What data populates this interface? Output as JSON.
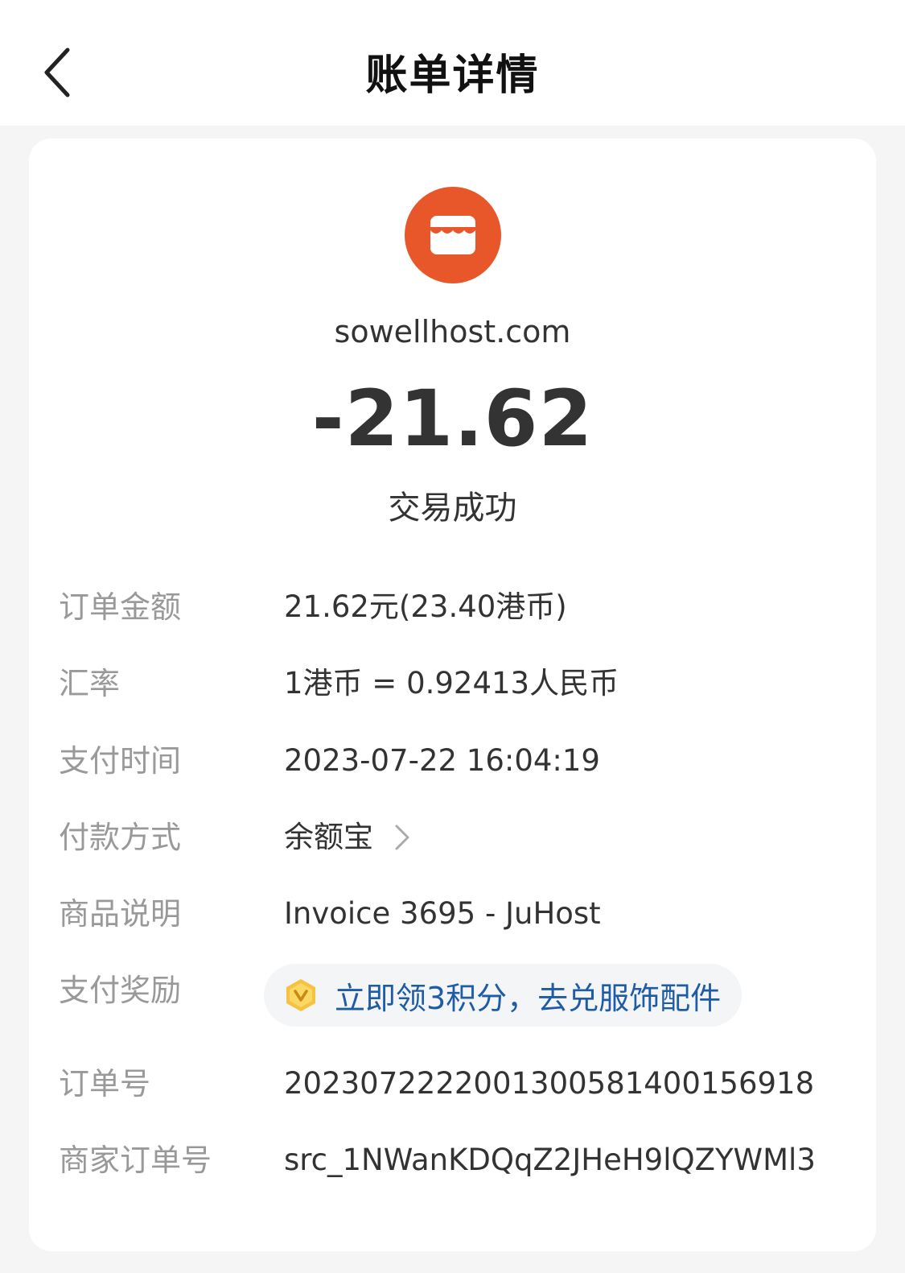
{
  "nav": {
    "title": "账单详情",
    "back_icon": "chevron-left-icon"
  },
  "merchant": {
    "name": "sowellhost.com",
    "logo_icon": "store-icon",
    "logo_color": "#e8572a"
  },
  "transaction": {
    "amount": "-21.62",
    "status": "交易成功"
  },
  "details": {
    "order_amount": {
      "label": "订单金额",
      "value": "21.62元(23.40港币)"
    },
    "exchange_rate": {
      "label": "汇率",
      "value": "1港币 = 0.92413人民币"
    },
    "pay_time": {
      "label": "支付时间",
      "value": "2023-07-22 16:04:19"
    },
    "pay_method": {
      "label": "付款方式",
      "value": "余额宝",
      "chevron_icon": "chevron-right-icon"
    },
    "product": {
      "label": "商品说明",
      "value": "Invoice 3695 - JuHost"
    },
    "reward": {
      "label": "支付奖励",
      "value": "立即领3积分，去兑服饰配件",
      "coin_icon": "coin-v-icon",
      "color": "#1f5ca6"
    },
    "order_no": {
      "label": "订单号",
      "value": "2023072222001300581400156918"
    },
    "merchant_order_no": {
      "label": "商家订单号",
      "value": "src_1NWanKDQqZ2JHeH9lQZYWMl3"
    }
  }
}
